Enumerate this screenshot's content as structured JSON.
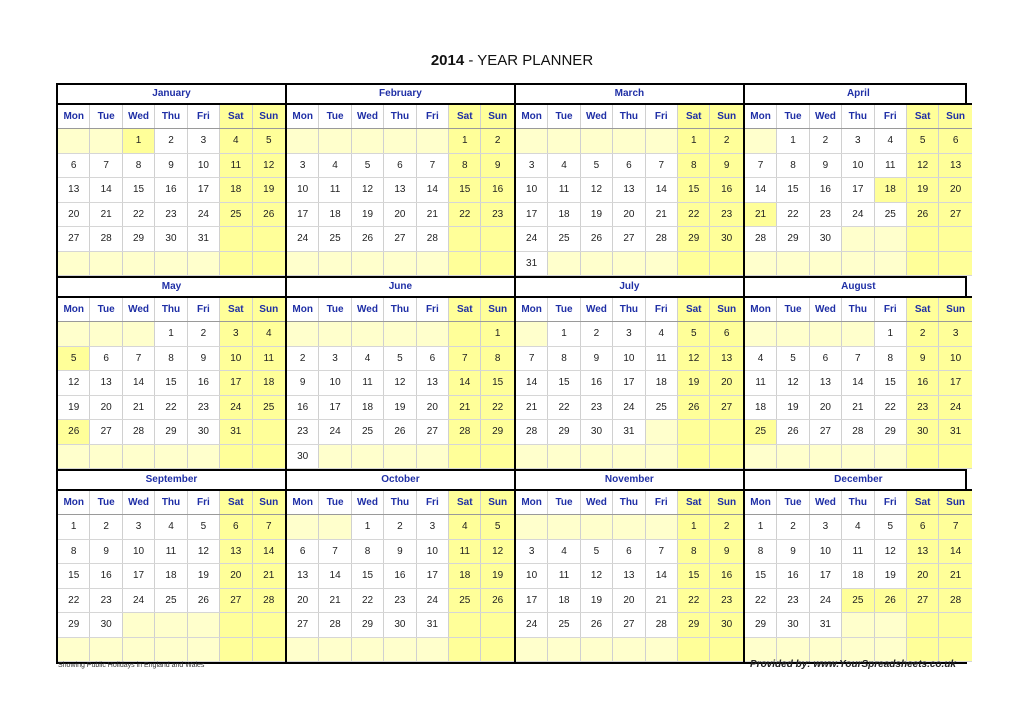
{
  "header": {
    "year": "2014",
    "title_suffix": " - YEAR PLANNER"
  },
  "weekdays": [
    "Mon",
    "Tue",
    "Wed",
    "Thu",
    "Fri",
    "Sat",
    "Sun"
  ],
  "year": 2014,
  "months": [
    {
      "name": "January",
      "days": 31,
      "start": 2,
      "holidays": [
        1
      ]
    },
    {
      "name": "February",
      "days": 28,
      "start": 5,
      "holidays": []
    },
    {
      "name": "March",
      "days": 31,
      "start": 5,
      "holidays": []
    },
    {
      "name": "April",
      "days": 30,
      "start": 1,
      "holidays": [
        18,
        21
      ]
    },
    {
      "name": "May",
      "days": 31,
      "start": 3,
      "holidays": [
        5,
        26
      ]
    },
    {
      "name": "June",
      "days": 30,
      "start": 6,
      "holidays": []
    },
    {
      "name": "July",
      "days": 31,
      "start": 1,
      "holidays": []
    },
    {
      "name": "August",
      "days": 31,
      "start": 4,
      "holidays": [
        25
      ]
    },
    {
      "name": "September",
      "days": 30,
      "start": 0,
      "holidays": []
    },
    {
      "name": "October",
      "days": 31,
      "start": 2,
      "holidays": []
    },
    {
      "name": "November",
      "days": 30,
      "start": 5,
      "holidays": []
    },
    {
      "name": "December",
      "days": 31,
      "start": 0,
      "holidays": [
        25,
        26
      ]
    }
  ],
  "footer": {
    "note": "Showing Public Holidays in England and Wales",
    "credit": "Provided by: www.YourSpreadsheets.co.uk"
  }
}
